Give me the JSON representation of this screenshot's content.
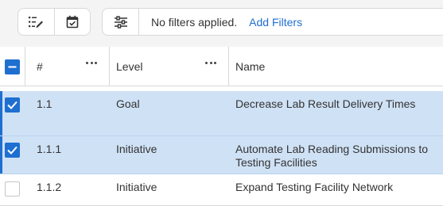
{
  "toolbar": {
    "buttons": [
      {
        "icon": "edit-list-icon"
      },
      {
        "icon": "calendar-check-icon"
      }
    ],
    "filter": {
      "icon": "filter-sliders-icon",
      "status_text": "No filters applied.",
      "add_label": "Add Filters"
    }
  },
  "table": {
    "columns": [
      {
        "label": "#"
      },
      {
        "label": "Level"
      },
      {
        "label": "Name"
      }
    ],
    "rows": [
      {
        "number": "1.1",
        "level": "Goal",
        "name_line1": "Decrease Lab Result Delivery Times",
        "name_line2": "",
        "selected": true
      },
      {
        "number": "1.1.1",
        "level": "Initiative",
        "name_line1": "Automate Lab Reading Submissions to",
        "name_line2": "Testing Facilities",
        "selected": true
      },
      {
        "number": "1.1.2",
        "level": "Initiative",
        "name_line1": "Expand Testing Facility Network",
        "name_line2": "",
        "selected": false
      }
    ]
  },
  "colors": {
    "accent": "#1f6fd1",
    "selected_row": "#cfe1f5"
  }
}
